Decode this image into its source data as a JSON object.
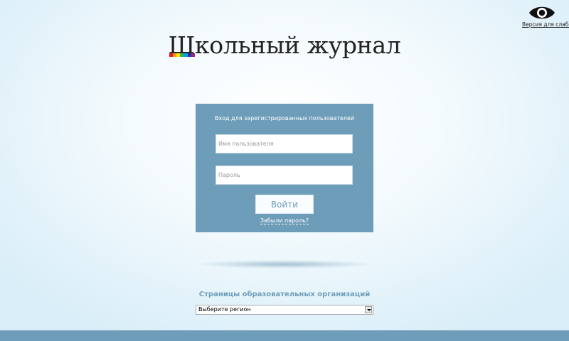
{
  "accessibility": {
    "label": "Версия для слабовидящих",
    "icon": "eye-icon"
  },
  "logo": {
    "first_letter": "Ш",
    "rest": "кольный журнал",
    "stripe_colors": [
      "#e31e24",
      "#f7941d",
      "#ffe600",
      "#39b54a",
      "#00a0e3",
      "#2e3192",
      "#92278f"
    ]
  },
  "login": {
    "title": "Вход для зарегистрированных пользователей",
    "username_placeholder": "Имя пользователя",
    "password_placeholder": "Пароль",
    "submit_label": "Войти",
    "forgot_label": "Забыли пароль?"
  },
  "organizations": {
    "label": "Страницы образовательных организаций",
    "region_select_value": "Выберите регион"
  },
  "colors": {
    "accent": "#6e9dba"
  }
}
